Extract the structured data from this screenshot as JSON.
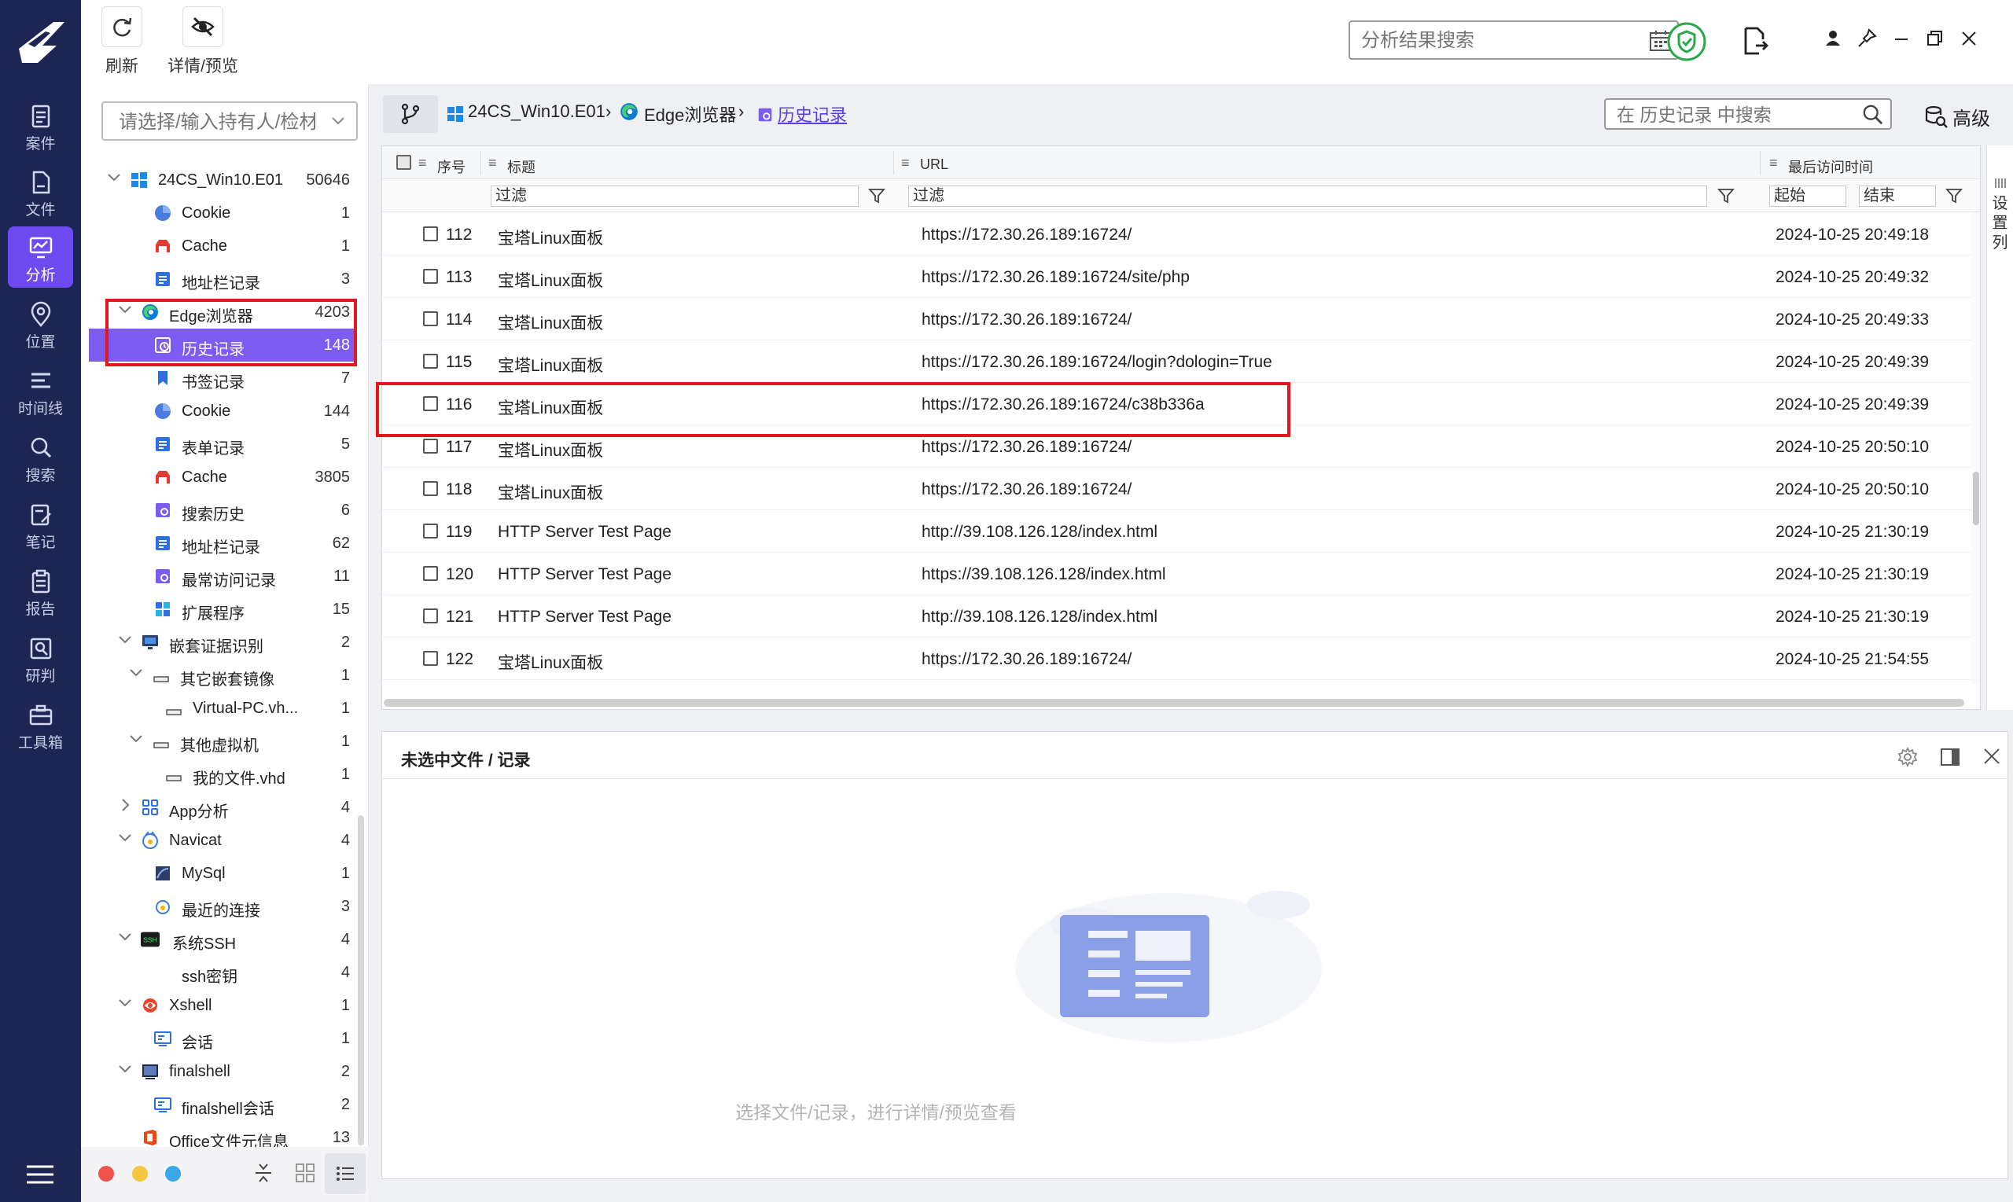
{
  "toolbar": {
    "refresh_label": "刷新",
    "detail_label": "详情/预览"
  },
  "global_search": {
    "placeholder": "分析结果搜索"
  },
  "nav": [
    {
      "label": "案件",
      "icon": "case-icon"
    },
    {
      "label": "文件",
      "icon": "file-icon"
    },
    {
      "label": "分析",
      "icon": "analysis-icon",
      "active": true
    },
    {
      "label": "位置",
      "icon": "location-icon"
    },
    {
      "label": "时间线",
      "icon": "timeline-icon"
    },
    {
      "label": "搜索",
      "icon": "search-icon"
    },
    {
      "label": "笔记",
      "icon": "note-icon"
    },
    {
      "label": "报告",
      "icon": "report-icon"
    },
    {
      "label": "研判",
      "icon": "judge-icon"
    },
    {
      "label": "工具箱",
      "icon": "toolbox-icon"
    }
  ],
  "holder_input": {
    "placeholder": "请选择/输入持有人/检材"
  },
  "tree": [
    {
      "label": "24CS_Win10.E01",
      "count": "50646"
    },
    {
      "label": "Cookie",
      "count": "1"
    },
    {
      "label": "Cache",
      "count": "1"
    },
    {
      "label": "地址栏记录",
      "count": "3"
    },
    {
      "label": "Edge浏览器",
      "count": "4203"
    },
    {
      "label": "历史记录",
      "count": "148"
    },
    {
      "label": "书签记录",
      "count": "7"
    },
    {
      "label": "Cookie",
      "count": "144"
    },
    {
      "label": "表单记录",
      "count": "5"
    },
    {
      "label": "Cache",
      "count": "3805"
    },
    {
      "label": "搜索历史",
      "count": "6"
    },
    {
      "label": "地址栏记录",
      "count": "62"
    },
    {
      "label": "最常访问记录",
      "count": "11"
    },
    {
      "label": "扩展程序",
      "count": "15"
    },
    {
      "label": "嵌套证据识别",
      "count": "2"
    },
    {
      "label": "其它嵌套镜像",
      "count": "1"
    },
    {
      "label": "Virtual-PC.vh...",
      "count": "1"
    },
    {
      "label": "其他虚拟机",
      "count": "1"
    },
    {
      "label": "我的文件.vhd",
      "count": "1"
    },
    {
      "label": "App分析",
      "count": "4"
    },
    {
      "label": "Navicat",
      "count": "4"
    },
    {
      "label": "MySql",
      "count": "1"
    },
    {
      "label": "最近的连接",
      "count": "3"
    },
    {
      "label": "系统SSH",
      "count": "4"
    },
    {
      "label": "ssh密钥",
      "count": "4"
    },
    {
      "label": "Xshell",
      "count": "1"
    },
    {
      "label": "会话",
      "count": "1"
    },
    {
      "label": "finalshell",
      "count": "2"
    },
    {
      "label": "finalshell会话",
      "count": "2"
    },
    {
      "label": "Office文件元信息",
      "count": "13"
    }
  ],
  "breadcrumb": {
    "root": "24CS_Win10.E01",
    "browser": "Edge浏览器",
    "current": "历史记录"
  },
  "table_search": {
    "placeholder": "在 历史记录 中搜索"
  },
  "advanced_label": "高级",
  "columns": {
    "index": "序号",
    "title": "标题",
    "url": "URL",
    "last_visit": "最后访问时间"
  },
  "filters": {
    "title": "过滤",
    "url": "过滤",
    "start": "起始",
    "end": "结束"
  },
  "settings_column_label": "设置列",
  "rows": [
    {
      "index": "112",
      "title": "宝塔Linux面板",
      "url": "https://172.30.26.189:16724/",
      "time": "2024-10-25 20:49:18"
    },
    {
      "index": "113",
      "title": "宝塔Linux面板",
      "url": "https://172.30.26.189:16724/site/php",
      "time": "2024-10-25 20:49:32"
    },
    {
      "index": "114",
      "title": "宝塔Linux面板",
      "url": "https://172.30.26.189:16724/",
      "time": "2024-10-25 20:49:33"
    },
    {
      "index": "115",
      "title": "宝塔Linux面板",
      "url": "https://172.30.26.189:16724/login?dologin=True",
      "time": "2024-10-25 20:49:39"
    },
    {
      "index": "116",
      "title": "宝塔Linux面板",
      "url": "https://172.30.26.189:16724/c38b336a",
      "time": "2024-10-25 20:49:39"
    },
    {
      "index": "117",
      "title": "宝塔Linux面板",
      "url": "https://172.30.26.189:16724/",
      "time": "2024-10-25 20:50:10"
    },
    {
      "index": "118",
      "title": "宝塔Linux面板",
      "url": "https://172.30.26.189:16724/",
      "time": "2024-10-25 20:50:10"
    },
    {
      "index": "119",
      "title": "HTTP Server Test Page",
      "url": "http://39.108.126.128/index.html",
      "time": "2024-10-25 21:30:19"
    },
    {
      "index": "120",
      "title": "HTTP Server Test Page",
      "url": "https://39.108.126.128/index.html",
      "time": "2024-10-25 21:30:19"
    },
    {
      "index": "121",
      "title": "HTTP Server Test Page",
      "url": "http://39.108.126.128/index.html",
      "time": "2024-10-25 21:30:19"
    },
    {
      "index": "122",
      "title": "宝塔Linux面板",
      "url": "https://172.30.26.189:16724/",
      "time": "2024-10-25 21:54:55"
    }
  ],
  "preview": {
    "title": "未选中文件 / 记录",
    "hint": "选择文件/记录，进行详情/预览查看"
  },
  "colors": {
    "rail": "#1d2553",
    "accent": "#6d4bf1",
    "selected_row": "#7d5cf3",
    "highlight": "#e3161e"
  }
}
